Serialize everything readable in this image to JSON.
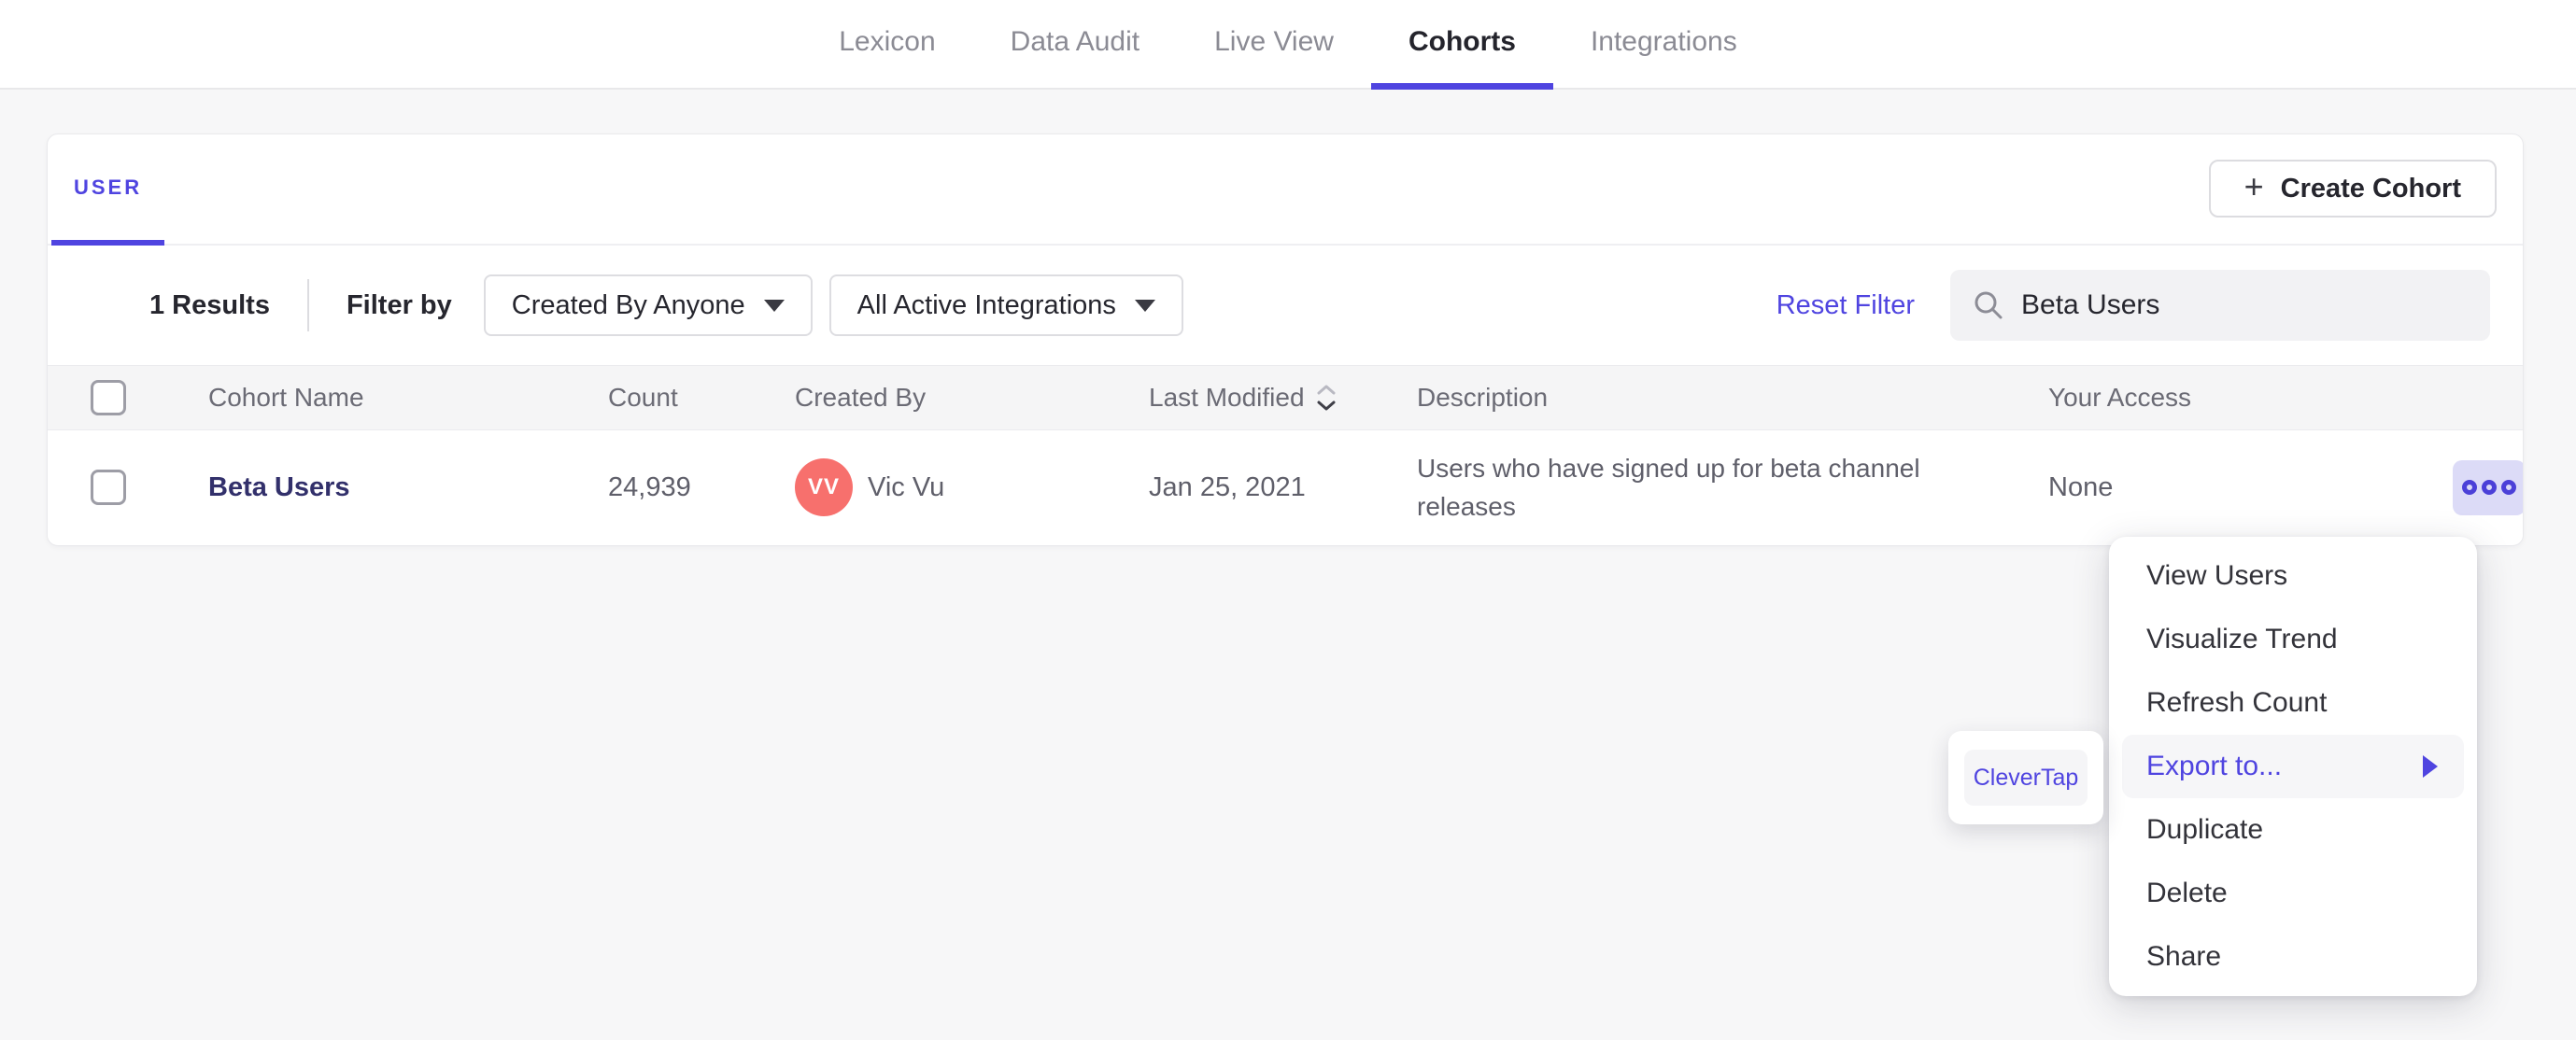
{
  "nav": {
    "items": [
      {
        "label": "Lexicon",
        "active": false
      },
      {
        "label": "Data Audit",
        "active": false
      },
      {
        "label": "Live View",
        "active": false
      },
      {
        "label": "Cohorts",
        "active": true
      },
      {
        "label": "Integrations",
        "active": false
      }
    ]
  },
  "cohorts_page": {
    "tab_label": "USER",
    "create_button": {
      "plus": "+",
      "label": "Create Cohort"
    },
    "filters": {
      "results_count": "1 Results",
      "filter_by_label": "Filter by",
      "created_by_dropdown": "Created By Anyone",
      "integrations_dropdown": "All Active Integrations",
      "reset_link": "Reset Filter",
      "search_value": "Beta Users"
    },
    "table": {
      "headers": [
        "Cohort Name",
        "Count",
        "Created By",
        "Last Modified",
        "Description",
        "Your Access"
      ],
      "row": {
        "name": "Beta Users",
        "count": "24,939",
        "created_by": "Vic Vu",
        "avatar_initials": "VV",
        "last_modified": "Jan 25, 2021",
        "description": "Users who have signed up for beta channel releases",
        "access": "None"
      }
    }
  },
  "context_menu": {
    "items": [
      "View Users",
      "Visualize Trend",
      "Refresh Count",
      "Export to...",
      "Duplicate",
      "Delete",
      "Share"
    ],
    "highlighted_item": "Export to..."
  },
  "export_submenu": {
    "items": [
      "CleverTap"
    ]
  },
  "colors": {
    "accent_purple": "#4f44e0",
    "cohort_link_navy": "#32306b",
    "avatar_coral": "#f7706d",
    "more_button_bg": "#dcdbf7",
    "page_bg": "#f7f7f8",
    "header_row_bg": "#f5f5f6",
    "search_bg": "#f2f2f4"
  }
}
